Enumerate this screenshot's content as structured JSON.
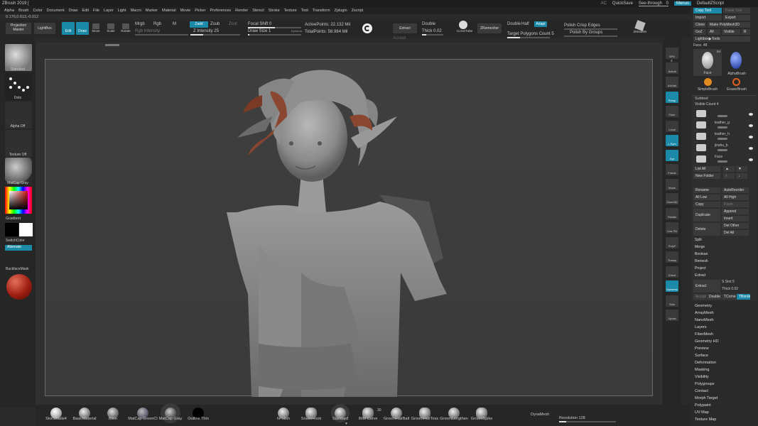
{
  "titlebar": {
    "title": "ZBrush 2019 [",
    "ac": "AC",
    "quicksave": "QuickSave",
    "see_through": "See-through",
    "see_through_value": "0",
    "menus": "Menus",
    "script": "DefaultZScript"
  },
  "menubar": [
    "Alpha",
    "Brush",
    "Color",
    "Document",
    "Draw",
    "Edit",
    "File",
    "Layer",
    "Light",
    "Macro",
    "Marker",
    "Material",
    "Movie",
    "Picker",
    "Preferences",
    "Render",
    "Stencil",
    "Stroke",
    "Texture",
    "Tool",
    "Transform",
    "Zplugin",
    "Zscript"
  ],
  "coords": "0.176,0.613,-0.012",
  "toptools": {
    "projection_master": "Projection Master",
    "lightbox": "LightBox",
    "edit": "Edit",
    "draw": "Draw",
    "move": "Move",
    "scale": "Scale",
    "rotate": "Rotate",
    "mrgb": "Mrgb",
    "rgb": "Rgb",
    "m": "M",
    "rgb_intensity": "Rgb Intensity",
    "zadd": "Zadd",
    "zsub": "Zsub",
    "zcut": "Zcut",
    "z_intensity": "Z Intensity",
    "z_intensity_value": "25",
    "focal_shift": "Focal Shift",
    "focal_shift_value": "0",
    "draw_size": "Draw Size",
    "draw_size_value": "1",
    "dynamic": "Dynamic",
    "active_points": "ActivePoints: 22.132 Mil",
    "total_points": "TotalPoints: 58.984 Mil",
    "extract": "Extract",
    "accept": "Accept",
    "double": "Double",
    "thick": "Thick",
    "thick_value": "0.02",
    "curve_tube": "CurveTube",
    "zremesher": "ZRemesher",
    "double2": "Double",
    "half": "Half",
    "adapt": "Adapt",
    "target_polys": "Target Polygons Count",
    "target_polys_value": "5",
    "polish_crisp": "Polish Crisp Edges",
    "polish_groups": "Polish By Groups",
    "zmodeler": "ZModeler"
  },
  "leftshelf": {
    "standard": "Standard",
    "dots": "Dots",
    "alpha_off": "Alpha Off",
    "texture_off": "Texture Off",
    "matcap": "MatCap Gray",
    "gradient": "Gradient",
    "switch_color": "SwitchColor",
    "alternate": "Alternate",
    "backface_mask": "BackfaceMask"
  },
  "rightshelf": [
    "SPix",
    "Actual",
    "AAHalf",
    "Persp",
    "Floor",
    "Local",
    "L.Sym",
    "Xyz",
    "Frame",
    "Move",
    "Zoom3D",
    "Rotate",
    "Line Fill",
    "PolyF",
    "Transp",
    "Ghost",
    "Dynamic",
    "Solo",
    "Xpose"
  ],
  "rightshelf_value": "3",
  "rightpanel": {
    "copy_tool": "Copy Tool",
    "paste_tool": "Paste Tool",
    "import": "Import",
    "export": "Export",
    "clone": "Clone",
    "make_polymesh": "Make PolyMesh3D",
    "goz": "GoZ",
    "all": "All",
    "visible": "Visible",
    "r": "R",
    "lightbox_tools": "Lightbox▶Tools",
    "face": "Face.",
    "face_value": "48",
    "face_count": "54",
    "tool_face": "Face",
    "tool_alphabrush": "AlphaBrush",
    "tool_simplebrush": "SimpleBrush",
    "tool_eraserbrush": "EraserBrush",
    "subtool": "Subtool",
    "visible_count": "Visible Count",
    "visible_count_value": "4",
    "subtools": [
      "",
      "leather_g",
      "leather_h",
      "jinshu_b",
      "Face"
    ],
    "list_all": "List All",
    "new_folder": "New Folder",
    "rename": "Rename",
    "autoreorder": "AutoReorder",
    "all_low": "All Low",
    "all_high": "All High",
    "copy": "Copy",
    "paste": "Paste",
    "duplicate": "Duplicate",
    "append": "Append",
    "insert": "Insert",
    "delete": "Delete",
    "del_other": "Del Other",
    "del_all": "Del All",
    "split": "Split",
    "merge": "Merge",
    "boolean": "Boolean",
    "remesh": "Remesh",
    "project": "Project",
    "extract": "Extract",
    "extract2": "Extract",
    "s_smt": "S Smt",
    "s_smt_value": "5",
    "thick": "Thick",
    "thick_value": "0.02",
    "accept": "Accept",
    "double": "Double",
    "tcorne": "TCorne",
    "tborde": "TBorde",
    "menus": [
      "Geometry",
      "ArrayMesh",
      "NanoMesh",
      "Layers",
      "FiberMesh",
      "Geometry HD",
      "Preview",
      "Surface",
      "Deformation",
      "Masking",
      "Visibility",
      "Polygroups",
      "Contact",
      "Morph Target",
      "Polypaint",
      "UV Map",
      "Texture Map"
    ]
  },
  "bottombar": {
    "materials": [
      "SkinShade4",
      "BasicMaterial",
      "Blinn",
      "MatCap GreenCl",
      "MatCap Gray",
      "Outline Thin"
    ],
    "brushes": [
      "hPolish",
      "SnakeHook",
      "Standard",
      "IMM Curve",
      "GroomHairBall",
      "GroomHairToss",
      "GroomLengthen",
      "GroomSpike"
    ],
    "brush_badge": "30",
    "dynamesh": "DynaMesh",
    "resolution": "Resolution",
    "resolution_value": "128"
  },
  "colors": {
    "accent": "#1a8aa8",
    "primary_color": "#cc1010"
  }
}
